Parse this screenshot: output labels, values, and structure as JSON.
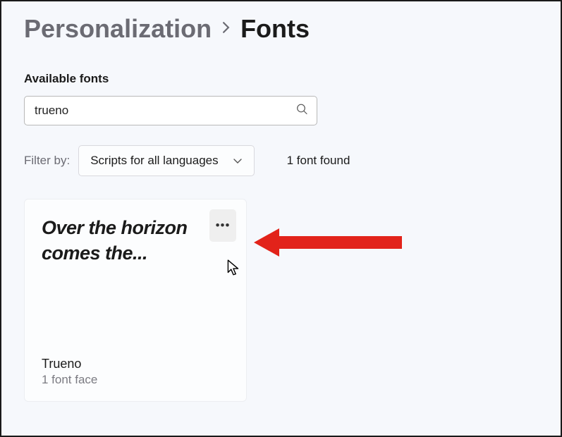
{
  "breadcrumb": {
    "parent": "Personalization",
    "current": "Fonts"
  },
  "section": {
    "heading": "Available fonts"
  },
  "search": {
    "value": "trueno",
    "placeholder": "Search"
  },
  "filter": {
    "label": "Filter by:",
    "selected": "Scripts for all languages"
  },
  "results": {
    "count_label": "1 font found"
  },
  "font_card": {
    "preview": "Over the horizon comes the...",
    "name": "Trueno",
    "faces": "1 font face"
  }
}
